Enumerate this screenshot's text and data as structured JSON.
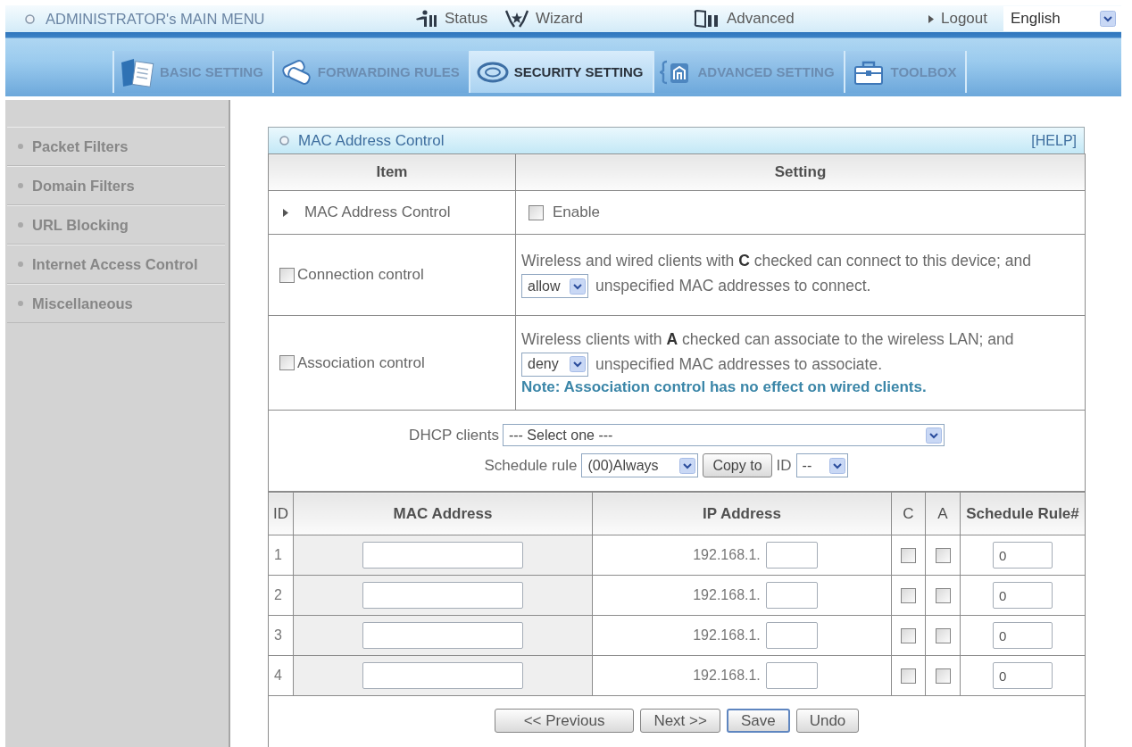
{
  "top_menu": {
    "title": "ADMINISTRATOR's MAIN MENU",
    "links": [
      {
        "label": "Status",
        "kind": "status"
      },
      {
        "label": "Wizard",
        "kind": "wizard"
      },
      {
        "label": "Advanced",
        "kind": "advanced"
      }
    ],
    "logout": "Logout",
    "language": "English"
  },
  "tabs": [
    {
      "label": "BASIC SETTING",
      "kind": "basic",
      "selected": false
    },
    {
      "label": "FORWARDING RULES",
      "kind": "forwarding",
      "selected": false
    },
    {
      "label": "SECURITY SETTING",
      "kind": "security",
      "selected": true
    },
    {
      "label": "ADVANCED SETTING",
      "kind": "advanced",
      "selected": false
    },
    {
      "label": "TOOLBOX",
      "kind": "toolbox",
      "selected": false
    }
  ],
  "sidebar": {
    "items": [
      {
        "label": "Packet Filters",
        "selected": false
      },
      {
        "label": "Domain Filters",
        "selected": false
      },
      {
        "label": "URL Blocking",
        "selected": false
      },
      {
        "label": "Internet Access Control",
        "selected": false
      },
      {
        "label": "Miscellaneous",
        "selected": false
      }
    ]
  },
  "panel": {
    "title": "MAC Address Control",
    "help": "[HELP]",
    "columns": [
      "Item",
      "Setting"
    ],
    "rows": [
      {
        "kind": "enable",
        "item": "MAC Address Control",
        "option": "Enable",
        "checked": false
      },
      {
        "kind": "control",
        "item": "Connection control",
        "checked": false,
        "description": "Wireless and wired clients with **C** checked can connect to this device; and",
        "policy": "allow",
        "policy_text": "unspecified MAC addresses to connect."
      },
      {
        "kind": "control",
        "item": "Association control",
        "checked": false,
        "description": "Wireless clients with **A** checked can associate to the wireless LAN; and",
        "policy": "deny",
        "policy_text": "unspecified MAC addresses to associate.",
        "note": "Note: Association control has no effect on wired clients."
      }
    ]
  },
  "dhcp": {
    "label": "DHCP clients",
    "value": "--- Select one ---",
    "schedule_label": "Schedule rule",
    "schedule_value": "(00)Always",
    "copy_button": "Copy to",
    "id_label": "ID",
    "id_value": "--"
  },
  "clients": {
    "columns": [
      "ID",
      "MAC Address",
      "IP Address",
      "C",
      "A",
      "Schedule Rule#"
    ],
    "rows": [
      {
        "id": "1",
        "ip_prefix": "192.168.1.",
        "c_checked": false,
        "a_checked": false,
        "schedule_rule": "0"
      },
      {
        "id": "2",
        "ip_prefix": "192.168.1.",
        "c_checked": false,
        "a_checked": false,
        "schedule_rule": "0"
      },
      {
        "id": "3",
        "ip_prefix": "192.168.1.",
        "c_checked": false,
        "a_checked": false,
        "schedule_rule": "0"
      },
      {
        "id": "4",
        "ip_prefix": "192.168.1.",
        "c_checked": false,
        "a_checked": false,
        "schedule_rule": "0"
      }
    ]
  },
  "buttons": [
    {
      "label": "<< Previous",
      "focused": false
    },
    {
      "label": "Next >>",
      "focused": false
    },
    {
      "label": "Save",
      "focused": true
    },
    {
      "label": "Undo",
      "focused": false
    }
  ]
}
